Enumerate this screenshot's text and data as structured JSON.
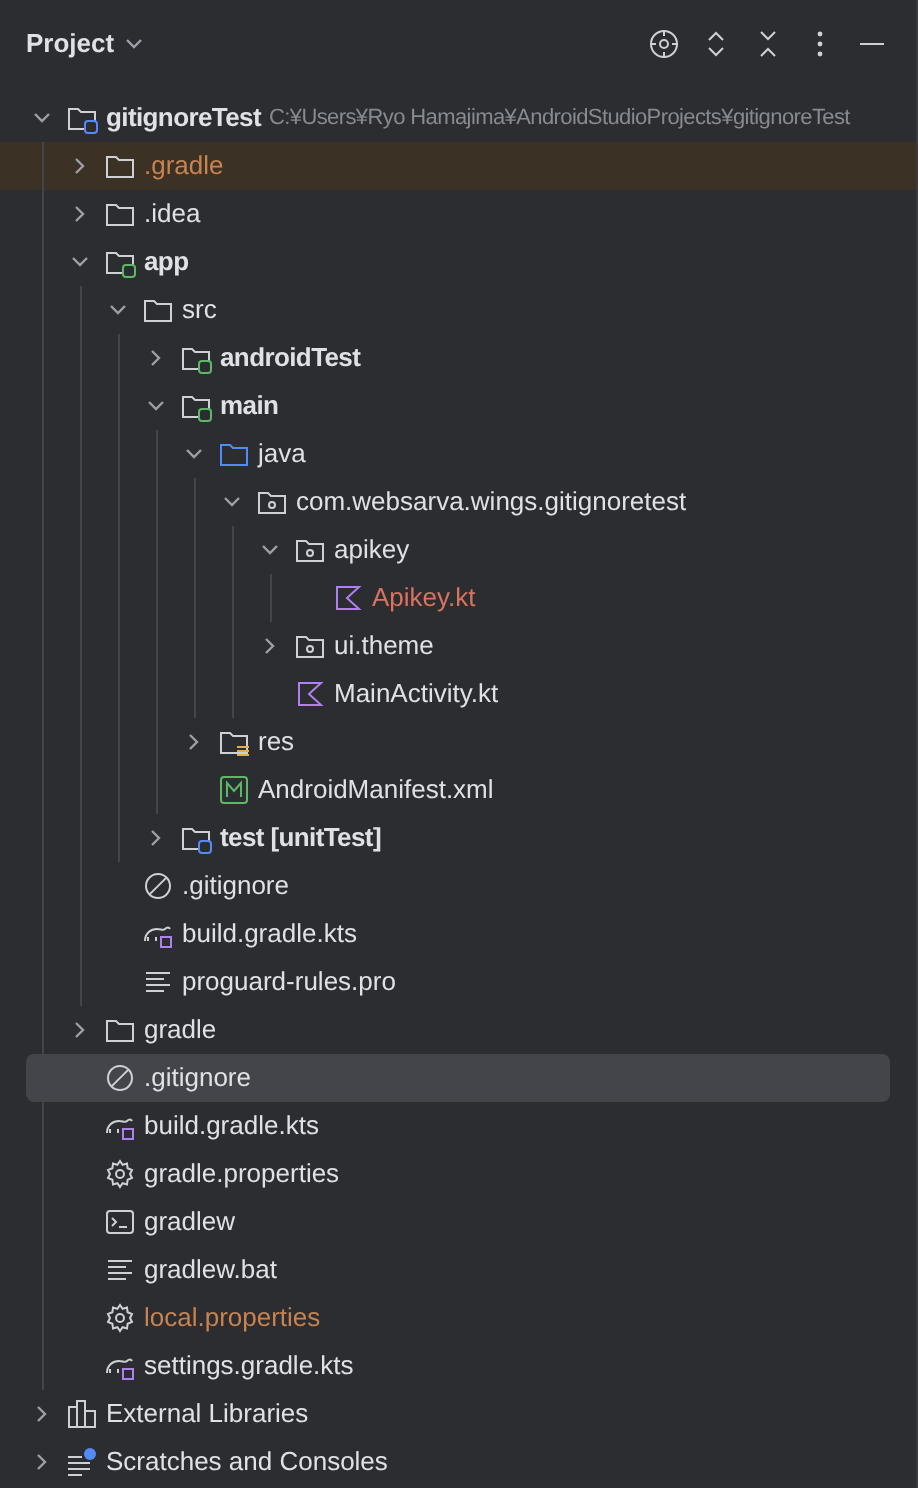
{
  "panel": {
    "title": "Project"
  },
  "tree": [
    {
      "label": "gitignoreTest",
      "kind": "module",
      "hint": "C:¥Users¥Ryo Hamajima¥AndroidStudioProjects¥gitignoreTest",
      "color": "#dfe1e5",
      "selected": false,
      "highlighted": false,
      "expanded": true,
      "children": [
        {
          "label": ".gradle",
          "kind": "folder",
          "color": "#c98350",
          "selected": false,
          "highlighted": true,
          "expanded": false
        },
        {
          "label": ".idea",
          "kind": "folder",
          "color": "#dfe1e5",
          "selected": false,
          "highlighted": false,
          "expanded": false
        },
        {
          "label": "app",
          "kind": "source_module",
          "color": "#dfe1e5",
          "selected": false,
          "highlighted": false,
          "expanded": true,
          "children": [
            {
              "label": "src",
              "kind": "folder",
              "color": "#dfe1e5",
              "selected": false,
              "highlighted": false,
              "expanded": true,
              "children": [
                {
                  "label": "androidTest",
                  "kind": "source_module",
                  "color": "#dfe1e5",
                  "selected": false,
                  "highlighted": false,
                  "expanded": false
                },
                {
                  "label": "main",
                  "kind": "source_module",
                  "color": "#dfe1e5",
                  "selected": false,
                  "highlighted": false,
                  "expanded": true,
                  "children": [
                    {
                      "label": "java",
                      "kind": "source_root",
                      "color": "#dfe1e5",
                      "selected": false,
                      "highlighted": false,
                      "expanded": true,
                      "children": [
                        {
                          "label": "com.websarva.wings.gitignoretest",
                          "kind": "package",
                          "color": "#dfe1e5",
                          "selected": false,
                          "highlighted": false,
                          "expanded": true,
                          "children": [
                            {
                              "label": "apikey",
                              "kind": "package",
                              "color": "#dfe1e5",
                              "selected": false,
                              "highlighted": false,
                              "expanded": true,
                              "children": [
                                {
                                  "label": "Apikey.kt",
                                  "kind": "kotlin",
                                  "color": "#d9725f",
                                  "selected": false,
                                  "highlighted": false
                                }
                              ]
                            },
                            {
                              "label": "ui.theme",
                              "kind": "package",
                              "color": "#dfe1e5",
                              "selected": false,
                              "highlighted": false,
                              "expanded": false
                            },
                            {
                              "label": "MainActivity.kt",
                              "kind": "kotlin",
                              "color": "#dfe1e5",
                              "selected": false,
                              "highlighted": false
                            }
                          ]
                        }
                      ]
                    },
                    {
                      "label": "res",
                      "kind": "resources",
                      "color": "#dfe1e5",
                      "selected": false,
                      "highlighted": false,
                      "expanded": false
                    },
                    {
                      "label": "AndroidManifest.xml",
                      "kind": "manifest",
                      "color": "#dfe1e5",
                      "selected": false,
                      "highlighted": false
                    }
                  ]
                },
                {
                  "label": "test [unitTest]",
                  "kind": "test_module",
                  "color": "#dfe1e5",
                  "selected": false,
                  "highlighted": false,
                  "expanded": false
                }
              ]
            },
            {
              "label": ".gitignore",
              "kind": "ignore",
              "color": "#dfe1e5",
              "selected": false,
              "highlighted": false
            },
            {
              "label": "build.gradle.kts",
              "kind": "gradle_kts",
              "color": "#dfe1e5",
              "selected": false,
              "highlighted": false
            },
            {
              "label": "proguard-rules.pro",
              "kind": "text",
              "color": "#dfe1e5",
              "selected": false,
              "highlighted": false
            }
          ]
        },
        {
          "label": "gradle",
          "kind": "folder",
          "color": "#dfe1e5",
          "selected": false,
          "highlighted": false,
          "expanded": false
        },
        {
          "label": ".gitignore",
          "kind": "ignore",
          "color": "#dfe1e5",
          "selected": true,
          "highlighted": false
        },
        {
          "label": "build.gradle.kts",
          "kind": "gradle_kts",
          "color": "#dfe1e5",
          "selected": false,
          "highlighted": false
        },
        {
          "label": "gradle.properties",
          "kind": "settings",
          "color": "#dfe1e5",
          "selected": false,
          "highlighted": false
        },
        {
          "label": "gradlew",
          "kind": "terminal",
          "color": "#dfe1e5",
          "selected": false,
          "highlighted": false
        },
        {
          "label": "gradlew.bat",
          "kind": "text",
          "color": "#dfe1e5",
          "selected": false,
          "highlighted": false
        },
        {
          "label": "local.properties",
          "kind": "settings",
          "color": "#c98350",
          "selected": false,
          "highlighted": false
        },
        {
          "label": "settings.gradle.kts",
          "kind": "gradle_kts",
          "color": "#dfe1e5",
          "selected": false,
          "highlighted": false
        }
      ]
    },
    {
      "label": "External Libraries",
      "kind": "libraries",
      "color": "#dfe1e5",
      "selected": false,
      "highlighted": false,
      "expanded": false
    },
    {
      "label": "Scratches and Consoles",
      "kind": "scratches",
      "color": "#dfe1e5",
      "selected": false,
      "highlighted": false,
      "expanded": false
    }
  ]
}
